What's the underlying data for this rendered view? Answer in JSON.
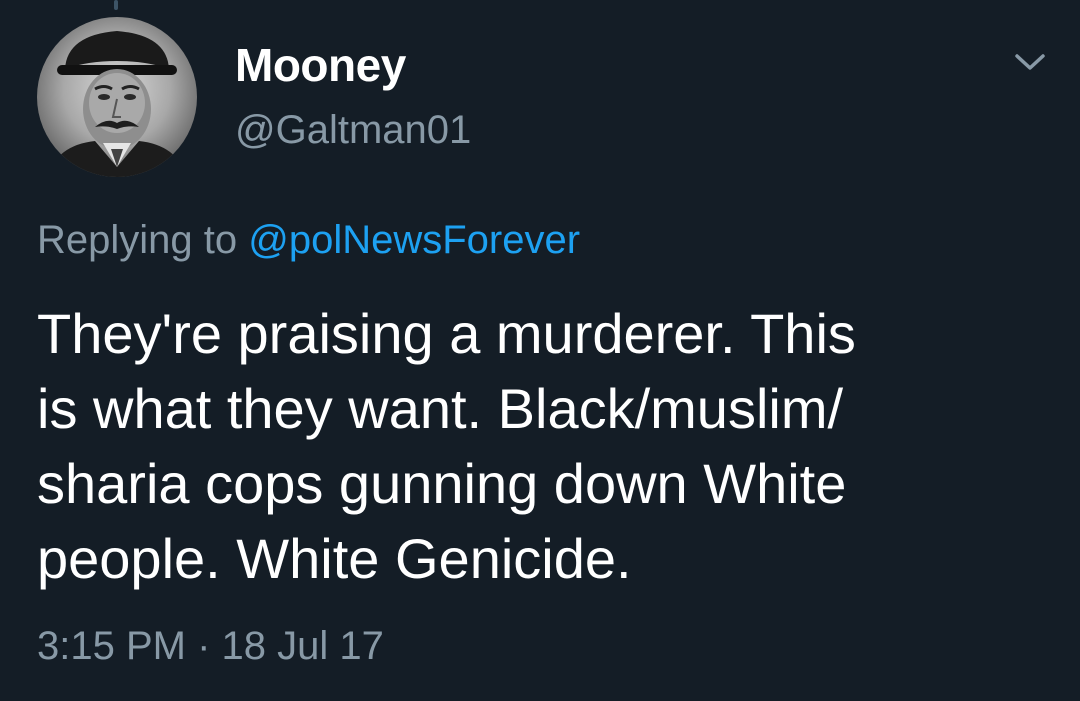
{
  "tweet": {
    "author": {
      "display_name": "Mooney",
      "handle": "@Galtman01"
    },
    "reply": {
      "prefix": "Replying to ",
      "mention": "@polNewsForever"
    },
    "text_lines": [
      "They're praising a murderer. This",
      "is what they want. Black/muslim/",
      "sharia cops gunning down White",
      "people. White Genicide."
    ],
    "timestamp": "3:15 PM · 18 Jul 17"
  },
  "icons": {
    "menu": "chevron-down-icon"
  },
  "colors": {
    "background": "#141d26",
    "primary_text": "#ffffff",
    "secondary_text": "#8899a6",
    "mention_blue": "#1da1f2"
  }
}
